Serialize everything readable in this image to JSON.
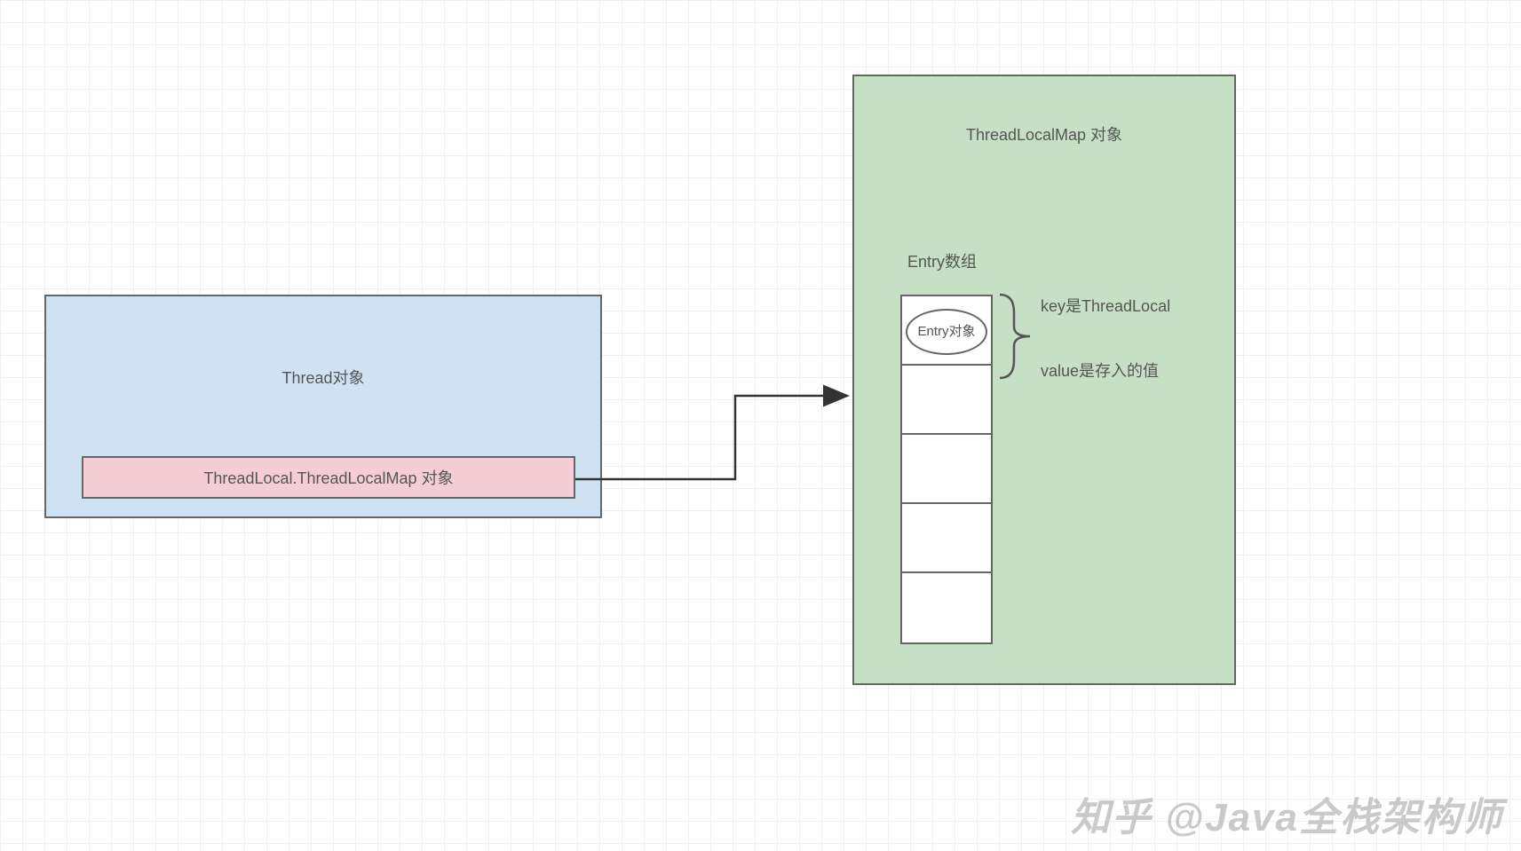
{
  "diagram": {
    "thread_box_title": "Thread对象",
    "inner_map_label": "ThreadLocal.ThreadLocalMap 对象",
    "map_box_title": "ThreadLocalMap 对象",
    "entry_array_label": "Entry数组",
    "entry_object_label": "Entry对象",
    "key_label": "key是ThreadLocal",
    "value_label": "value是存入的值",
    "entry_slot_count": 5,
    "watermark": "知乎 @Java全栈架构师"
  }
}
